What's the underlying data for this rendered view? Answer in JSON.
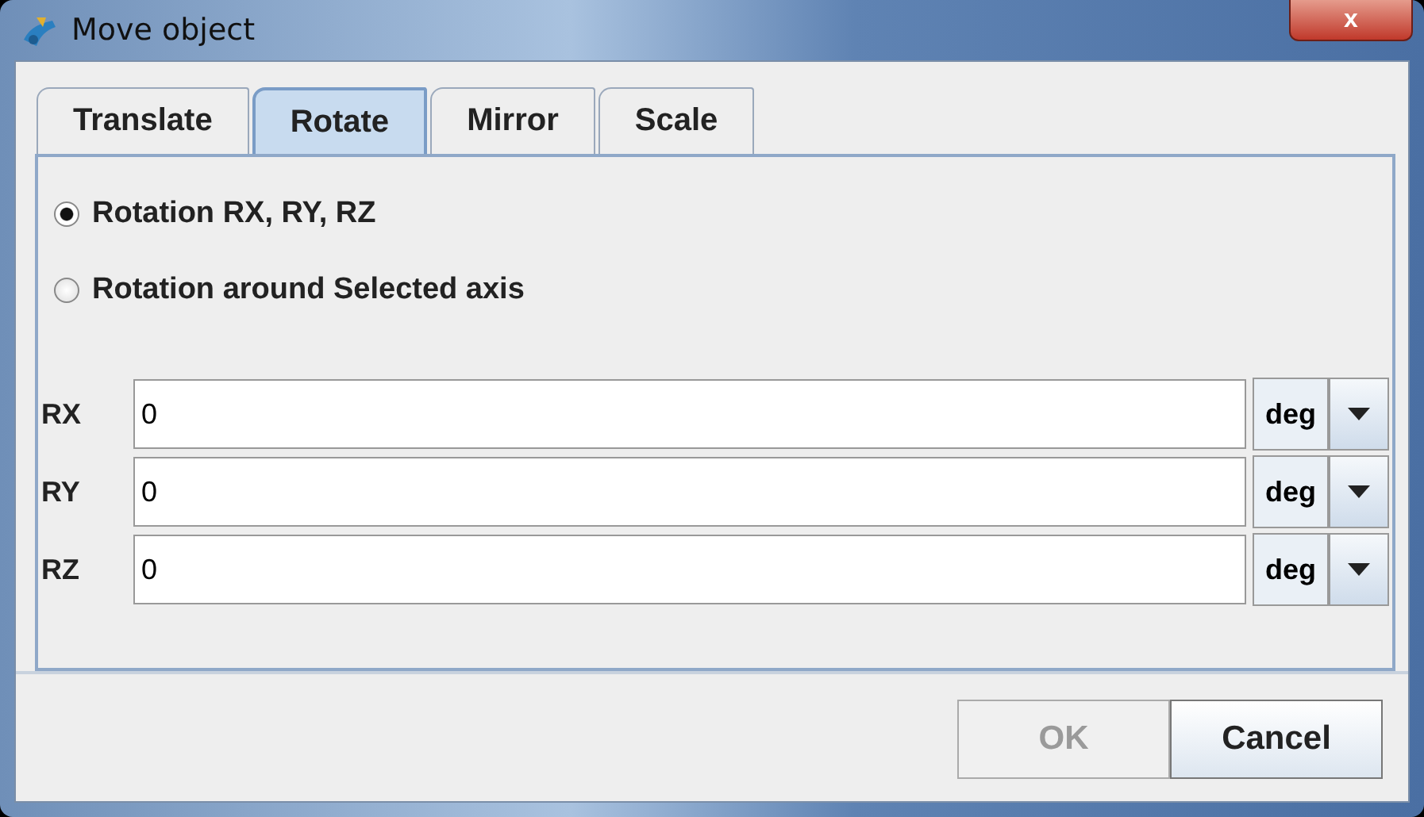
{
  "window": {
    "title": "Move object",
    "close": "x"
  },
  "tabs": [
    {
      "label": "Translate",
      "selected": false
    },
    {
      "label": "Rotate",
      "selected": true
    },
    {
      "label": "Mirror",
      "selected": false
    },
    {
      "label": "Scale",
      "selected": false
    }
  ],
  "options": [
    {
      "label": "Rotation RX, RY, RZ",
      "selected": true
    },
    {
      "label": "Rotation around Selected axis",
      "selected": false
    }
  ],
  "fields": [
    {
      "label": "RX",
      "value": "0",
      "unit": "deg"
    },
    {
      "label": "RY",
      "value": "0",
      "unit": "deg"
    },
    {
      "label": "RZ",
      "value": "0",
      "unit": "deg"
    }
  ],
  "buttons": [
    {
      "label": "OK",
      "disabled": true
    },
    {
      "label": "Cancel",
      "disabled": false
    }
  ]
}
